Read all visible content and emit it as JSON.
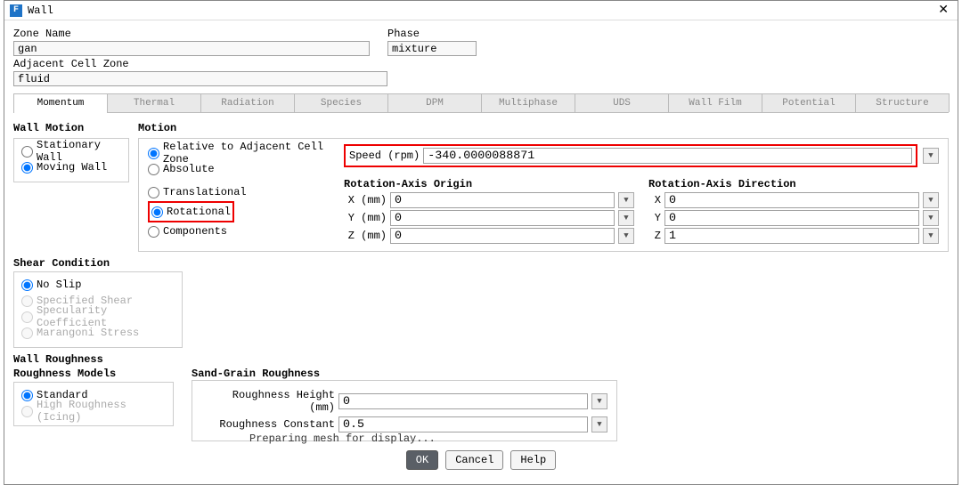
{
  "window": {
    "title": "Wall"
  },
  "zone_name_label": "Zone Name",
  "zone_name_value": "gan",
  "phase_label": "Phase",
  "phase_value": "mixture",
  "adjacent_label": "Adjacent Cell Zone",
  "adjacent_value": "fluid",
  "tabs": {
    "momentum": "Momentum",
    "thermal": "Thermal",
    "radiation": "Radiation",
    "species": "Species",
    "dpm": "DPM",
    "multiphase": "Multiphase",
    "uds": "UDS",
    "wall_film": "Wall Film",
    "potential": "Potential",
    "structure": "Structure"
  },
  "wall_motion": {
    "title": "Wall Motion",
    "stationary": "Stationary Wall",
    "moving": "Moving Wall"
  },
  "motion": {
    "title": "Motion",
    "relative": "Relative to Adjacent Cell Zone",
    "absolute": "Absolute",
    "translational": "Translational",
    "rotational": "Rotational",
    "components": "Components",
    "speed_label": "Speed (rpm)",
    "speed_value": "-340.0000088871",
    "origin_title": "Rotation-Axis Origin",
    "direction_title": "Rotation-Axis Direction",
    "x_label": "X (mm)",
    "y_label": "Y (mm)",
    "z_label": "Z (mm)",
    "ox": "0",
    "oy": "0",
    "oz": "0",
    "dx_label": "X",
    "dy_label": "Y",
    "dz_label": "Z",
    "dx": "0",
    "dy": "0",
    "dz": "1"
  },
  "shear": {
    "title": "Shear Condition",
    "no_slip": "No Slip",
    "specified": "Specified Shear",
    "specularity": "Specularity Coefficient",
    "marangoni": "Marangoni Stress"
  },
  "roughness": {
    "title": "Wall Roughness",
    "models_title": "Roughness Models",
    "standard": "Standard",
    "high": "High Roughness (Icing)",
    "sg_title": "Sand-Grain Roughness",
    "height_label": "Roughness Height (mm)",
    "height_value": "0",
    "constant_label": "Roughness Constant",
    "constant_value": "0.5"
  },
  "buttons": {
    "ok": "OK",
    "cancel": "Cancel",
    "help": "Help"
  },
  "footer": "Preparing mesh for display..."
}
